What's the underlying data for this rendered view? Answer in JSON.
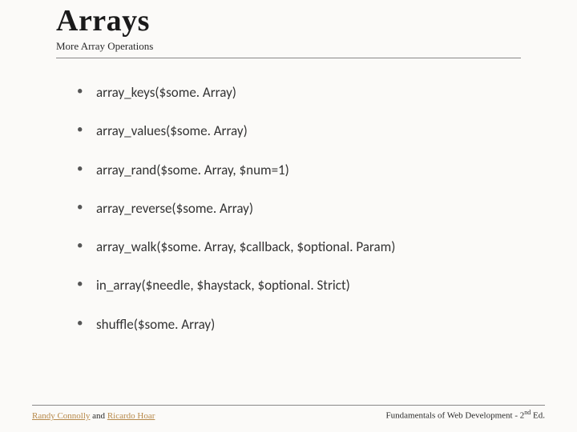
{
  "header": {
    "title": "Arrays",
    "subtitle": "More Array Operations"
  },
  "bullets": [
    "array_keys($some. Array)",
    "array_values($some. Array)",
    "array_rand($some. Array, $num=1)",
    "array_reverse($some. Array)",
    "array_walk($some. Array, $callback, $optional. Param)",
    "in_array($needle, $haystack, $optional. Strict)",
    "shuffle($some. Array)"
  ],
  "footer": {
    "author1": "Randy Connolly",
    "joiner": " and ",
    "author2": "Ricardo Hoar",
    "book_prefix": "Fundamentals of Web Development - 2",
    "book_super": "nd",
    "book_suffix": " Ed."
  }
}
